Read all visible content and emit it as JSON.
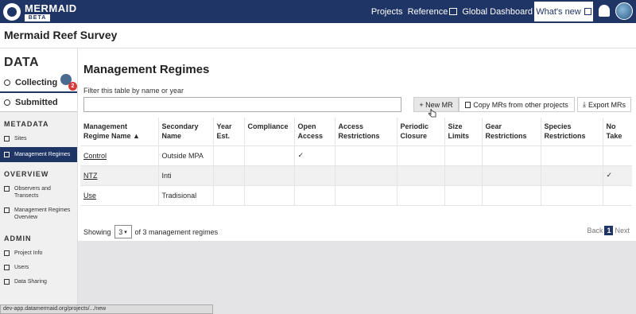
{
  "app": {
    "logo_title": "MERMAID",
    "logo_badge": "BETA",
    "nav": [
      "Projects",
      "Reference",
      "Global Dashboard"
    ],
    "whats_new": "What's new"
  },
  "project": {
    "title": "Mermaid Reef Survey"
  },
  "sidebar": {
    "data_heading": "DATA",
    "collecting": "Collecting",
    "collecting_badge": "2",
    "submitted": "Submitted",
    "metadata_heading": "METADATA",
    "metadata_items": [
      "Sites",
      "Management Regimes"
    ],
    "overview_heading": "OVERVIEW",
    "overview_items": [
      "Observers and Transects",
      "Management Regimes Overview"
    ],
    "admin_heading": "ADMIN",
    "admin_items": [
      "Project Info",
      "Users",
      "Data Sharing"
    ]
  },
  "main": {
    "title": "Management Regimes",
    "filter_label": "Filter this table by name or year",
    "filter_value": "",
    "new_button": "+ New MR",
    "copy_button": "Copy MRs from other projects",
    "export_button": "Export MRs",
    "columns": [
      "Management Regime Name ▲",
      "Secondary Name",
      "Year Est.",
      "Compliance",
      "Open Access",
      "Access Restrictions",
      "Periodic Closure",
      "Size Limits",
      "Gear Restrictions",
      "Species Restrictions",
      "No Take"
    ],
    "rows": [
      {
        "name": "Control",
        "secondary": "Outside MPA",
        "open_access": "✓",
        "no_take": ""
      },
      {
        "name": "NTZ",
        "secondary": "Inti",
        "open_access": "",
        "no_take": "✓"
      },
      {
        "name": "Use",
        "secondary": "Tradisional",
        "open_access": "",
        "no_take": ""
      }
    ],
    "showing_label": "Showing",
    "page_size": "3",
    "showing_suffix": "of 3 management regimes",
    "pager_back": "Back",
    "pager_current": "1",
    "pager_next": "Next"
  },
  "status_url": "dev-app.datamermaid.org/projects/.../new",
  "colors": {
    "brand": "#1f3566",
    "badge": "#d83a3a"
  }
}
